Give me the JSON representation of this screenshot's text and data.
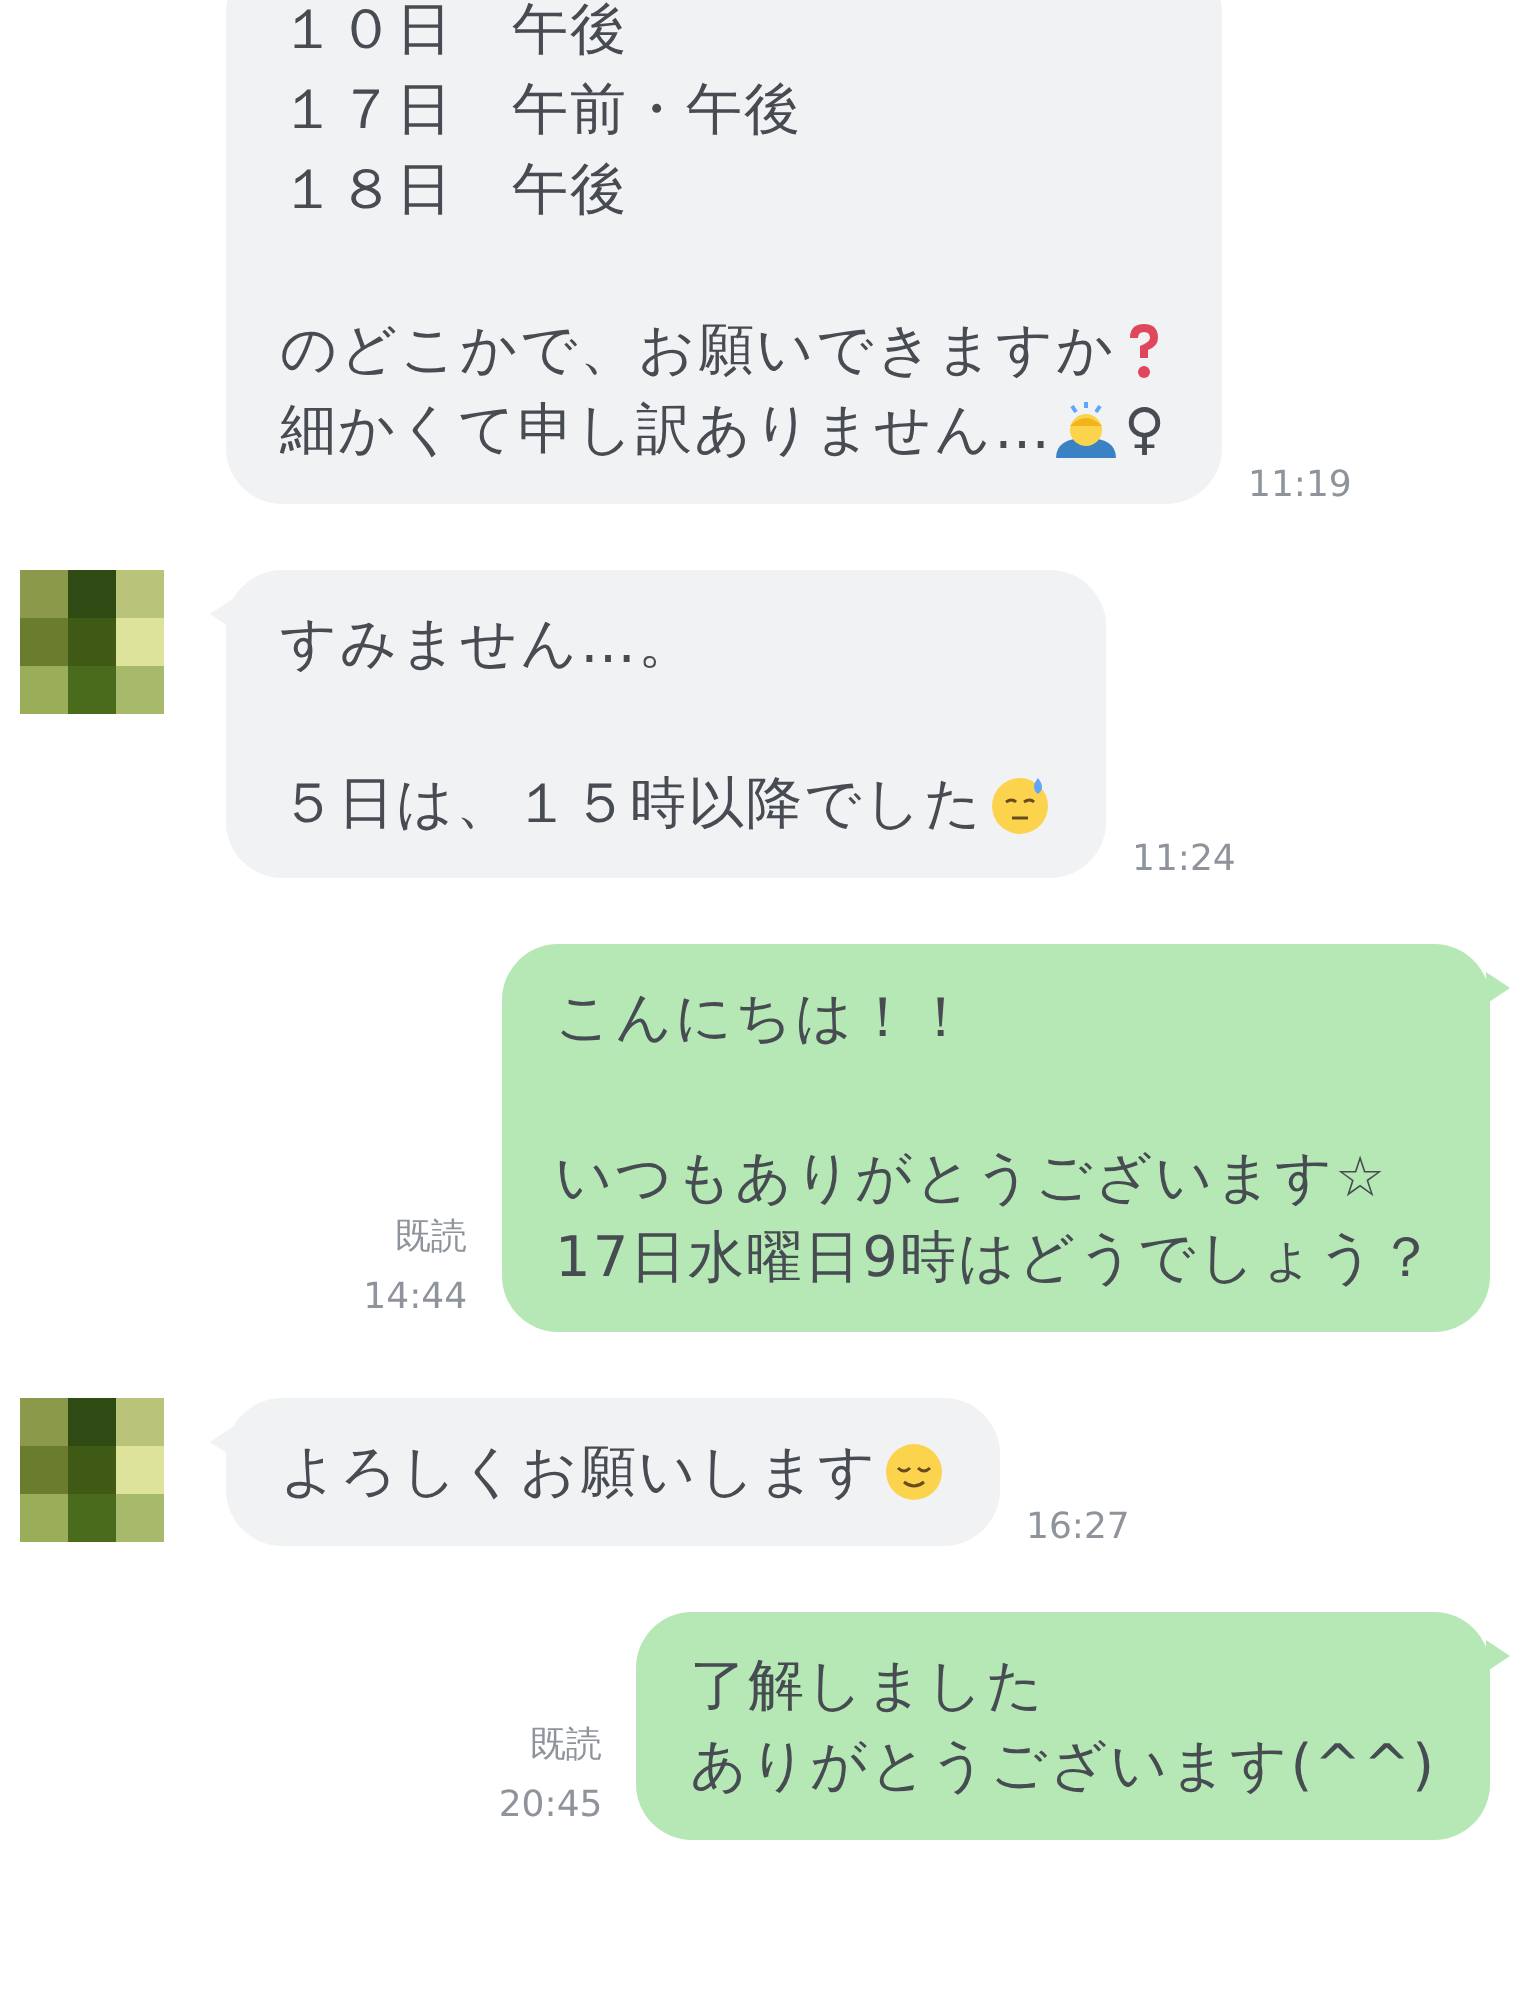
{
  "messages": [
    {
      "kind": "incoming",
      "avatar": false,
      "time": "11:19",
      "lines": [
        {
          "text": "１０日　午後",
          "kind": "plain"
        },
        {
          "text": "１７日　午前・午後",
          "kind": "plain"
        },
        {
          "text": "１８日　午後",
          "kind": "plain"
        },
        {
          "kind": "blank"
        },
        {
          "text": "のどこかで、お願いできますか",
          "kind": "question"
        },
        {
          "text": "細かくて申し訳ありません…",
          "kind": "bow",
          "suffix": "♀"
        }
      ]
    },
    {
      "kind": "incoming",
      "avatar": true,
      "time": "11:24",
      "lines": [
        {
          "text": "すみません…。",
          "kind": "plain"
        },
        {
          "kind": "blank"
        },
        {
          "text": "５日は、１５時以降でした",
          "kind": "sweat"
        }
      ]
    },
    {
      "kind": "outgoing",
      "read": "既読",
      "time": "14:44",
      "lines": [
        {
          "text": "こんにちは！！",
          "kind": "plain"
        },
        {
          "kind": "blank"
        },
        {
          "text": "いつもありがとうございます☆",
          "kind": "plain"
        },
        {
          "text": "17日水曜日9時はどうでしょう？",
          "kind": "plain"
        }
      ]
    },
    {
      "kind": "incoming",
      "avatar": true,
      "time": "16:27",
      "lines": [
        {
          "text": "よろしくお願いします",
          "kind": "relieved"
        }
      ]
    },
    {
      "kind": "outgoing",
      "read": "既読",
      "time": "20:45",
      "lines": [
        {
          "text": "了解しました",
          "kind": "plain"
        },
        {
          "text": "ありがとうございます(^^)",
          "kind": "plain"
        }
      ]
    }
  ]
}
